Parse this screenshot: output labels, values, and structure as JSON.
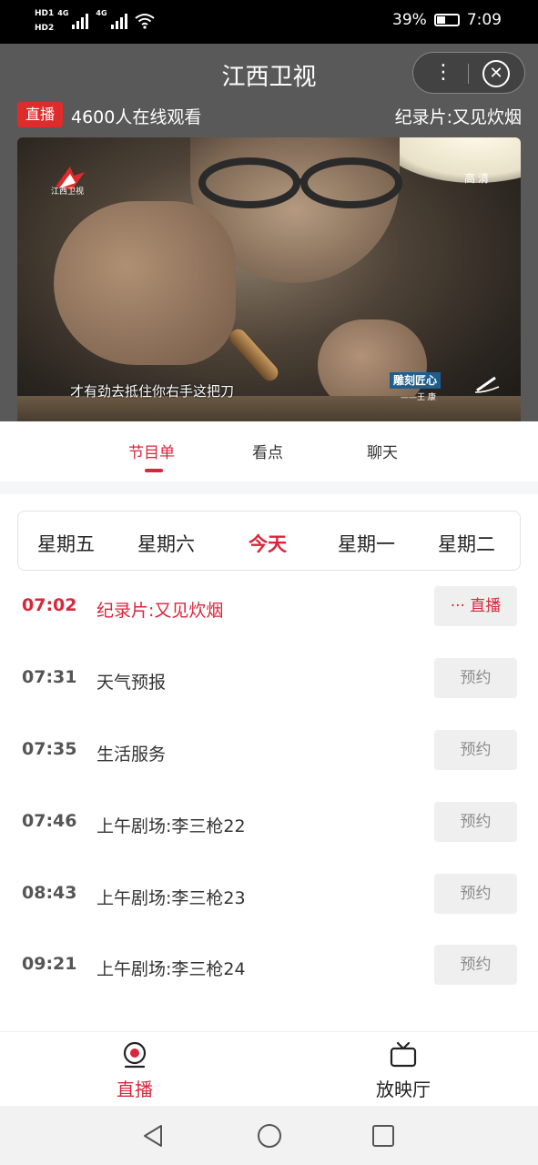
{
  "status_bar": {
    "hd1": "HD1",
    "hd2": "HD2",
    "net1": "4G",
    "net2": "4G",
    "battery": "39%",
    "time": "7:09"
  },
  "header": {
    "title": "江西卫视",
    "live_badge": "直播",
    "viewers": "4600人在线观看",
    "now_playing": "纪录片:又见炊烟"
  },
  "video": {
    "channel_logo_text": "江西卫视",
    "quality": "高清",
    "subtitle": "才有劲去抵住你右手这把刀",
    "show_badge": "雕刻匠心",
    "host": "——王 康"
  },
  "tabs": [
    {
      "label": "节目单",
      "active": true
    },
    {
      "label": "看点",
      "active": false
    },
    {
      "label": "聊天",
      "active": false
    }
  ],
  "days": [
    {
      "label": "星期五",
      "active": false
    },
    {
      "label": "星期六",
      "active": false
    },
    {
      "label": "今天",
      "active": true
    },
    {
      "label": "星期一",
      "active": false
    },
    {
      "label": "星期二",
      "active": false
    }
  ],
  "schedule": [
    {
      "time": "07:02",
      "title": "纪录片:又见炊烟",
      "action": "··· 直播",
      "current": true
    },
    {
      "time": "07:31",
      "title": "天气预报",
      "action": "预约",
      "current": false
    },
    {
      "time": "07:35",
      "title": "生活服务",
      "action": "预约",
      "current": false
    },
    {
      "time": "07:46",
      "title": "上午剧场:李三枪22",
      "action": "预约",
      "current": false
    },
    {
      "time": "08:43",
      "title": "上午剧场:李三枪23",
      "action": "预约",
      "current": false
    },
    {
      "time": "09:21",
      "title": "上午剧场:李三枪24",
      "action": "预约",
      "current": false
    }
  ],
  "bottom_nav": [
    {
      "label": "直播",
      "icon": "live-icon",
      "active": true
    },
    {
      "label": "放映厅",
      "icon": "tv-icon",
      "active": false
    }
  ],
  "colors": {
    "accent": "#d8263a",
    "header_bg": "#5a5959",
    "button_bg": "#efefef"
  }
}
